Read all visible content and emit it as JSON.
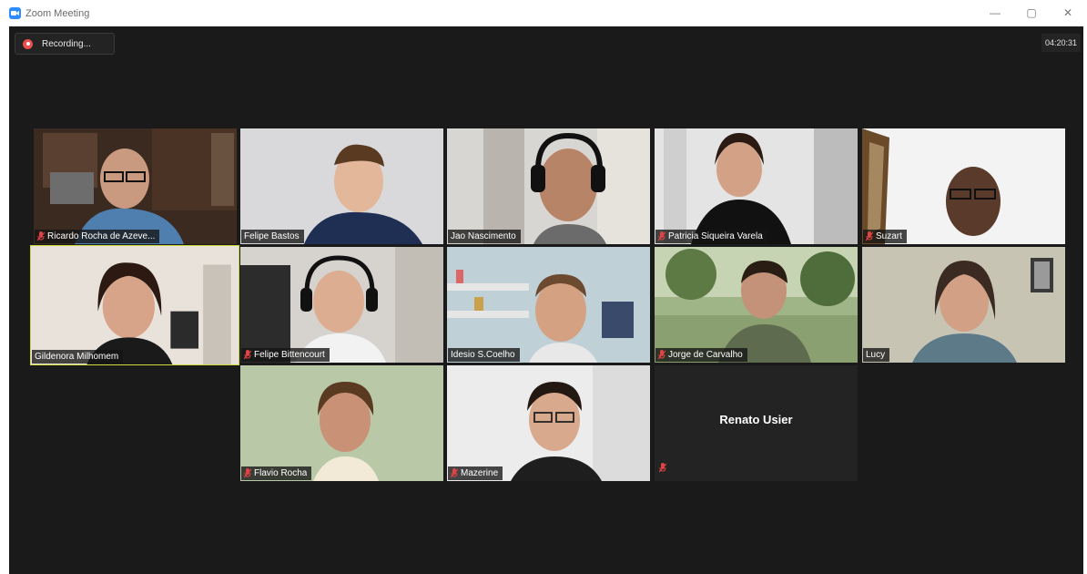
{
  "window": {
    "title": "Zoom Meeting",
    "controls": {
      "minimize": "—",
      "restore": "▢",
      "close": "✕"
    }
  },
  "recording": {
    "label": "Recording..."
  },
  "timer": "04:20:31",
  "colors": {
    "stage": "#1a1a1a",
    "active_speaker": "#cddb3a",
    "muted_mic": "#e04343",
    "recording": "#ec4d4d",
    "brand": "#2d8cff"
  },
  "participants": [
    {
      "name": "Ricardo Rocha de Azeve...",
      "muted": true,
      "video": true
    },
    {
      "name": "Felipe Bastos",
      "muted": false,
      "video": true
    },
    {
      "name": "Jao Nascimento",
      "muted": false,
      "video": true
    },
    {
      "name": "Patricia Siqueira Varela",
      "muted": true,
      "video": true
    },
    {
      "name": "Suzart",
      "muted": true,
      "video": true
    },
    {
      "name": "Gildenora Milhomem",
      "muted": false,
      "video": true,
      "active_speaker": true
    },
    {
      "name": "Felipe Bittencourt",
      "muted": true,
      "video": true
    },
    {
      "name": "Idesio S.Coelho",
      "muted": false,
      "video": true
    },
    {
      "name": "Jorge de Carvalho",
      "muted": true,
      "video": true
    },
    {
      "name": "Lucy",
      "muted": false,
      "video": true
    },
    {
      "name": "Flavio Rocha",
      "muted": true,
      "video": true
    },
    {
      "name": "Mazerine",
      "muted": true,
      "video": true
    },
    {
      "name": "Renato Usier",
      "muted": true,
      "video": false
    }
  ]
}
